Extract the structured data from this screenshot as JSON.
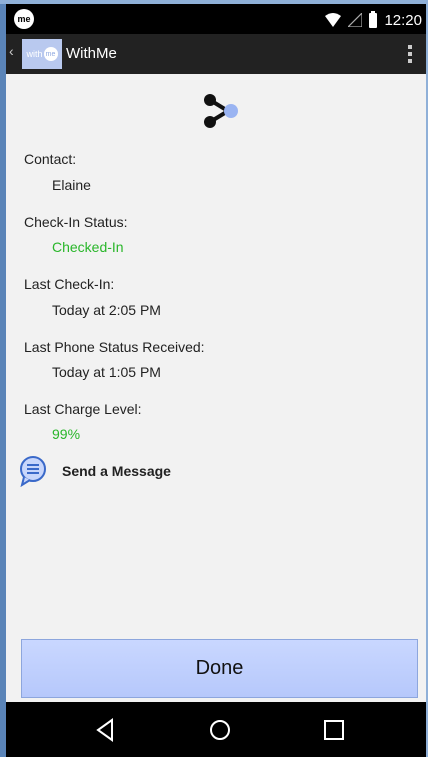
{
  "status_bar": {
    "app_icon_label": "me",
    "time": "12:20"
  },
  "action_bar": {
    "logo_text": "with",
    "logo_me": "me",
    "title": "WithMe"
  },
  "fields": [
    {
      "label": "Contact:",
      "value": "Elaine",
      "value_color": "#222222"
    },
    {
      "label": "Check-In Status:",
      "value": "Checked-In",
      "value_color": "#29b62a"
    },
    {
      "label": "Last Check-In:",
      "value": "Today at 2:05 PM",
      "value_color": "#222222"
    },
    {
      "label": "Last Phone Status Received:",
      "value": "Today at 1:05 PM",
      "value_color": "#222222"
    },
    {
      "label": "Last Charge Level:",
      "value": "99%",
      "value_color": "#29b62a"
    }
  ],
  "send_message_label": "Send a Message",
  "done_label": "Done",
  "colors": {
    "accent": "#b6c8fb",
    "status_green": "#29b62a",
    "status_bar": "#000000",
    "action_bar": "#222222"
  },
  "icons": [
    "app-icon",
    "wifi-icon",
    "signal-icon",
    "battery-icon",
    "overflow-menu-icon",
    "withme-logo-icon",
    "message-bubble-icon",
    "nav-back-icon",
    "nav-home-icon",
    "nav-recent-icon"
  ]
}
